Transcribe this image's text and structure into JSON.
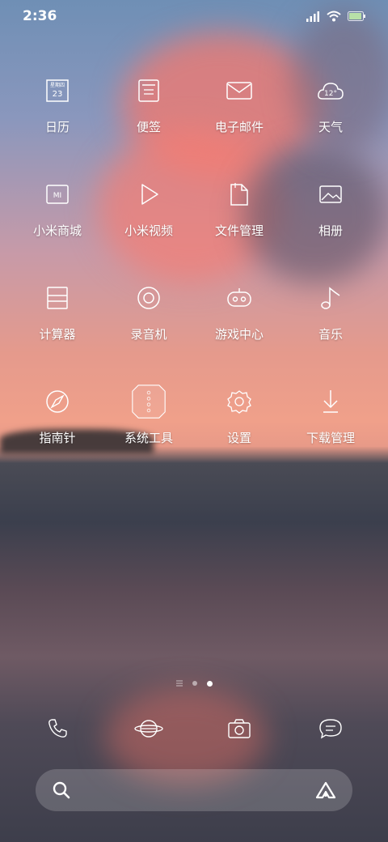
{
  "status": {
    "time": "2:36"
  },
  "apps": [
    [
      {
        "label": "日历",
        "icon": "calendar-icon",
        "weekday": "星期四",
        "day": "23"
      },
      {
        "label": "便签",
        "icon": "notes-icon"
      },
      {
        "label": "电子邮件",
        "icon": "email-icon"
      },
      {
        "label": "天气",
        "icon": "weather-icon",
        "temp": "12°"
      }
    ],
    [
      {
        "label": "小米商城",
        "icon": "mi-store-icon",
        "badge": "MI"
      },
      {
        "label": "小米视频",
        "icon": "video-icon"
      },
      {
        "label": "文件管理",
        "icon": "file-manager-icon"
      },
      {
        "label": "相册",
        "icon": "gallery-icon"
      }
    ],
    [
      {
        "label": "计算器",
        "icon": "calculator-icon"
      },
      {
        "label": "录音机",
        "icon": "recorder-icon"
      },
      {
        "label": "游戏中心",
        "icon": "game-center-icon"
      },
      {
        "label": "音乐",
        "icon": "music-icon"
      }
    ],
    [
      {
        "label": "指南针",
        "icon": "compass-icon"
      },
      {
        "label": "系统工具",
        "icon": "system-tools-folder-icon"
      },
      {
        "label": "设置",
        "icon": "settings-icon"
      },
      {
        "label": "下载管理",
        "icon": "download-icon"
      }
    ]
  ],
  "dock": [
    "phone-icon",
    "browser-icon",
    "camera-icon",
    "messages-icon"
  ],
  "search": {
    "left_icon": "search-icon",
    "right_icon": "assistant-icon"
  }
}
